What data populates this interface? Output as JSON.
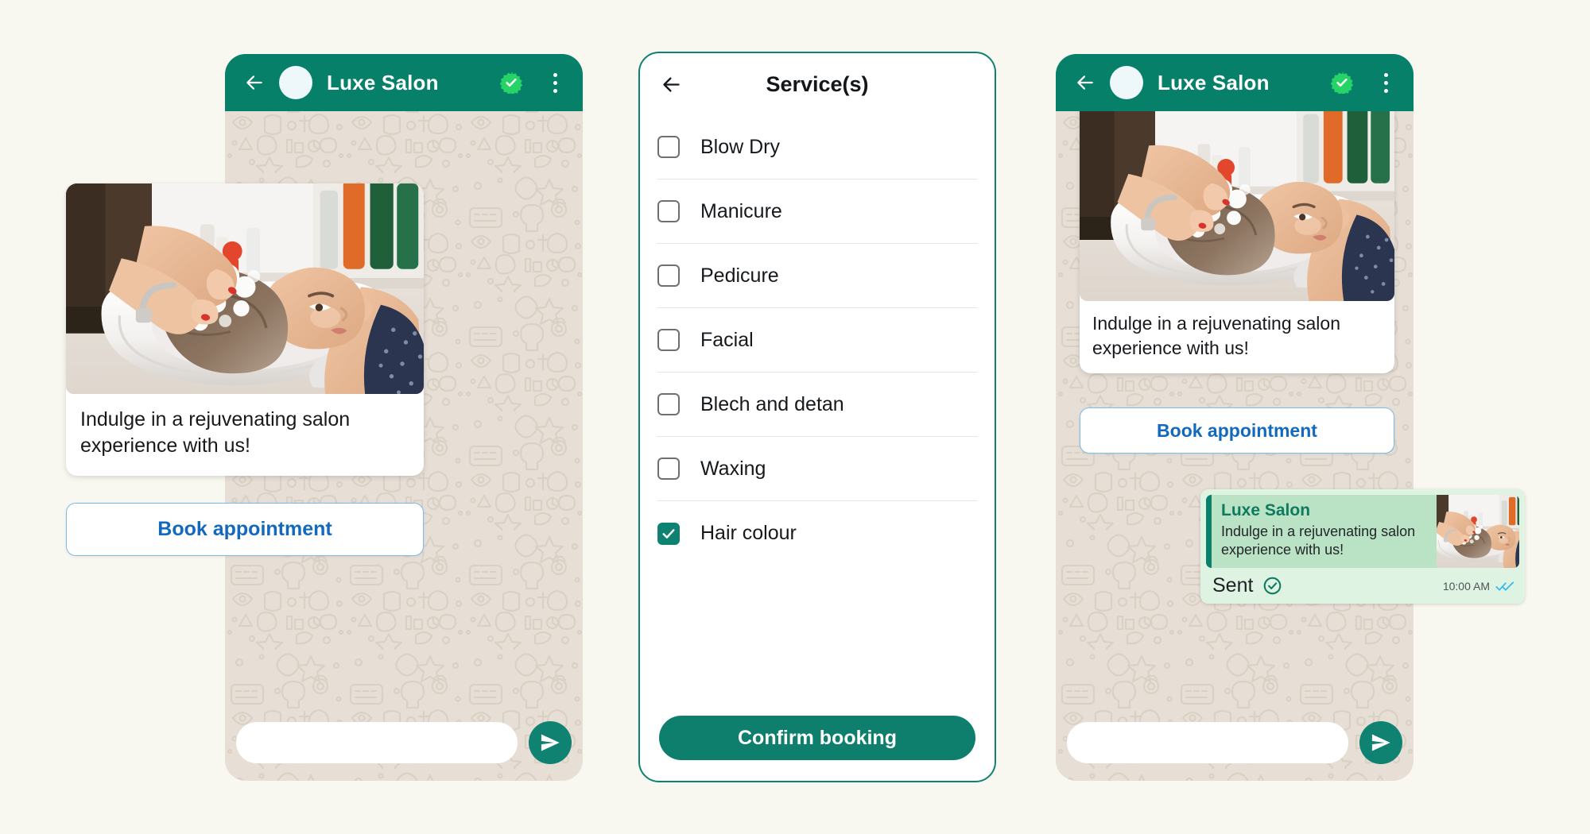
{
  "colors": {
    "page_bg": "#f8f8f0",
    "wa_header_green": "#07806a",
    "chat_wallpaper": "#e7dfd6",
    "accent_teal": "#0e8271",
    "cta_blue": "#1269bd",
    "cta_border_blue": "#7cbced",
    "bubble_green": "#dff3e3",
    "quote_green": "#b9e3c4",
    "verified_green": "#25d366",
    "tick_blue": "#34b7f1"
  },
  "panels": {
    "chat_before": {
      "header": {
        "back_icon": "arrow-left-icon",
        "avatar": "contact-avatar",
        "title": "Luxe Salon",
        "verified_icon": "verified-badge-icon",
        "menu_icon": "overflow-menu-icon"
      },
      "card": {
        "image_alt": "salon-hair-wash-photo",
        "text": "Indulge in a rejuvenating salon experience with us!"
      },
      "cta_label": "Book appointment",
      "composer": {
        "placeholder": "",
        "value": "",
        "send_icon": "send-icon"
      }
    },
    "service_picker": {
      "back_icon": "arrow-left-icon",
      "title": "Service(s)",
      "services": [
        {
          "label": "Blow Dry",
          "checked": false
        },
        {
          "label": "Manicure",
          "checked": false
        },
        {
          "label": "Pedicure",
          "checked": false
        },
        {
          "label": "Facial",
          "checked": false
        },
        {
          "label": "Blech and detan",
          "checked": false
        },
        {
          "label": "Waxing",
          "checked": false
        },
        {
          "label": "Hair colour",
          "checked": true
        }
      ],
      "confirm_label": "Confirm booking"
    },
    "chat_after": {
      "header": {
        "back_icon": "arrow-left-icon",
        "avatar": "contact-avatar",
        "title": "Luxe Salon",
        "verified_icon": "verified-badge-icon",
        "menu_icon": "overflow-menu-icon"
      },
      "card": {
        "image_alt": "salon-hair-wash-photo",
        "text": "Indulge in a rejuvenating salon experience with us!"
      },
      "cta_label": "Book appointment",
      "outgoing": {
        "quoted_title": "Luxe Salon",
        "quoted_text": "Indulge in a rejuvenating salon experience with us!",
        "quoted_thumb_alt": "salon-hair-wash-thumbnail",
        "status_label": "Sent",
        "status_icon": "check-circle-icon",
        "timestamp": "10:00 AM",
        "ticks_icon": "double-check-icon"
      },
      "composer": {
        "placeholder": "",
        "value": "",
        "send_icon": "send-icon"
      }
    }
  }
}
